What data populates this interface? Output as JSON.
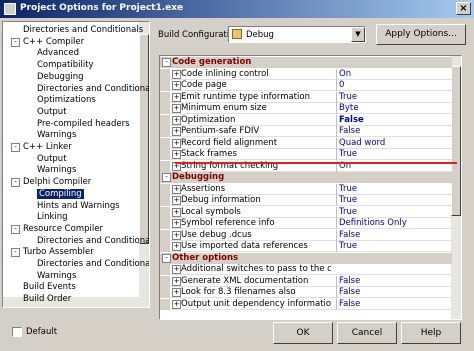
{
  "window": {
    "title": "Project Options for Project1.exe"
  },
  "tree": [
    {
      "label": "Directories and Conditionals",
      "depth": 1,
      "expander": ""
    },
    {
      "label": "C++ Compiler",
      "depth": 1,
      "expander": "-"
    },
    {
      "label": "Advanced",
      "depth": 2,
      "expander": ""
    },
    {
      "label": "Compatibility",
      "depth": 2,
      "expander": ""
    },
    {
      "label": "Debugging",
      "depth": 2,
      "expander": ""
    },
    {
      "label": "Directories and Conditional",
      "depth": 2,
      "expander": ""
    },
    {
      "label": "Optimizations",
      "depth": 2,
      "expander": ""
    },
    {
      "label": "Output",
      "depth": 2,
      "expander": ""
    },
    {
      "label": "Pre-compiled headers",
      "depth": 2,
      "expander": ""
    },
    {
      "label": "Warnings",
      "depth": 2,
      "expander": ""
    },
    {
      "label": "C++ Linker",
      "depth": 1,
      "expander": "-"
    },
    {
      "label": "Output",
      "depth": 2,
      "expander": ""
    },
    {
      "label": "Warnings",
      "depth": 2,
      "expander": ""
    },
    {
      "label": "Delphi Compiler",
      "depth": 1,
      "expander": "-"
    },
    {
      "label": "Compiling",
      "depth": 2,
      "expander": "",
      "selected": true
    },
    {
      "label": "Hints and Warnings",
      "depth": 2,
      "expander": ""
    },
    {
      "label": "Linking",
      "depth": 2,
      "expander": ""
    },
    {
      "label": "Resource Compiler",
      "depth": 1,
      "expander": "-"
    },
    {
      "label": "Directories and Conditional",
      "depth": 2,
      "expander": ""
    },
    {
      "label": "Turbo Assembler",
      "depth": 1,
      "expander": "-"
    },
    {
      "label": "Directories and Conditional",
      "depth": 2,
      "expander": ""
    },
    {
      "label": "Warnings",
      "depth": 2,
      "expander": ""
    },
    {
      "label": "Build Events",
      "depth": 1,
      "expander": ""
    },
    {
      "label": "Build Order",
      "depth": 1,
      "expander": ""
    }
  ],
  "build_config": {
    "label": "Build Configuration",
    "value": "Debug",
    "apply_label": "Apply Options..."
  },
  "grid": [
    {
      "type": "cat",
      "title": "Code generation"
    },
    {
      "type": "row",
      "name": "Code inlining control",
      "value": "On"
    },
    {
      "type": "row",
      "name": "Code page",
      "value": "0"
    },
    {
      "type": "row",
      "name": "Emit runtime type information",
      "value": "True"
    },
    {
      "type": "row",
      "name": "Minimum enum size",
      "value": "Byte"
    },
    {
      "type": "row",
      "name": "Optimization",
      "value": "False",
      "bold": true
    },
    {
      "type": "row",
      "name": "Pentium-safe FDIV",
      "value": "False"
    },
    {
      "type": "row",
      "name": "Record field alignment",
      "value": "Quad word"
    },
    {
      "type": "row",
      "name": "Stack frames",
      "value": "True"
    },
    {
      "type": "row",
      "name": "String format checking",
      "value": "On"
    },
    {
      "type": "cat",
      "title": "Debugging"
    },
    {
      "type": "row",
      "name": "Assertions",
      "value": "True"
    },
    {
      "type": "row",
      "name": "Debug information",
      "value": "True"
    },
    {
      "type": "row",
      "name": "Local symbols",
      "value": "True"
    },
    {
      "type": "row",
      "name": "Symbol reference info",
      "value": "Definitions Only"
    },
    {
      "type": "row",
      "name": "Use debug .dcus",
      "value": "False"
    },
    {
      "type": "row",
      "name": "Use imported data references",
      "value": "True"
    },
    {
      "type": "cat",
      "title": "Other options"
    },
    {
      "type": "row",
      "name": "Additional switches to pass to the compiler",
      "value": ""
    },
    {
      "type": "row",
      "name": "Generate XML documentation",
      "value": "False"
    },
    {
      "type": "row",
      "name": "Look for 8.3 filenames also",
      "value": "False"
    },
    {
      "type": "row",
      "name": "Output unit dependency information",
      "value": "False"
    }
  ],
  "footer": {
    "default_label": "Default",
    "ok": "OK",
    "cancel": "Cancel",
    "help": "Help"
  },
  "icons": {
    "close": "close-icon",
    "combo": "configuration-icon"
  }
}
